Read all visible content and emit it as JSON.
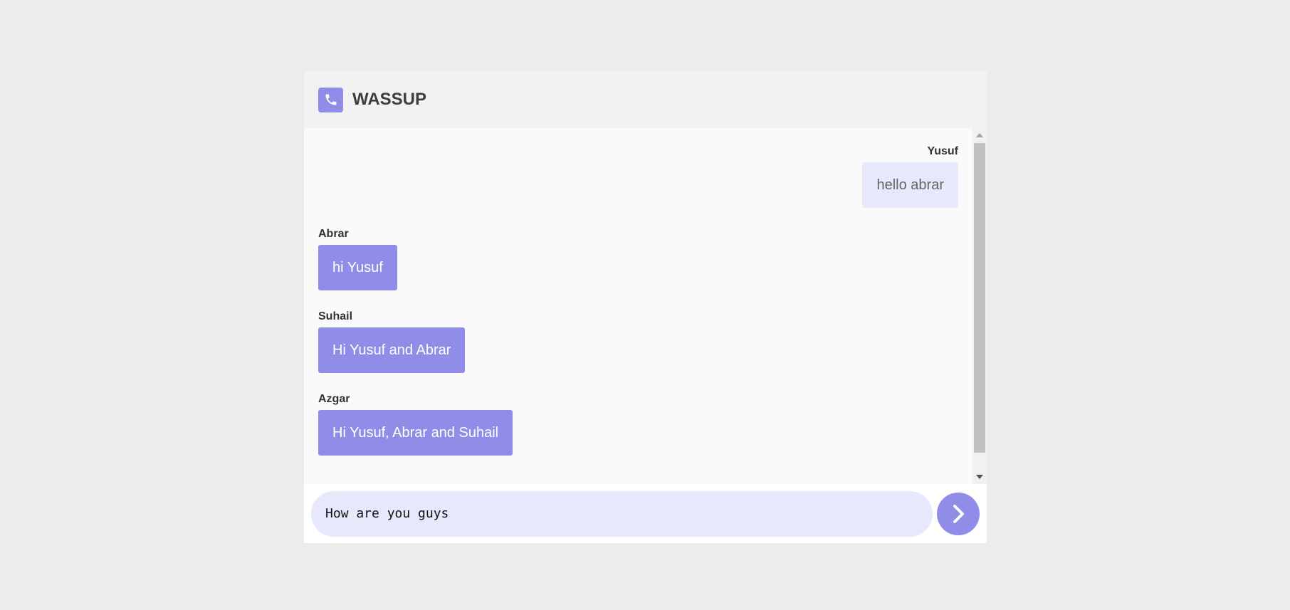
{
  "app": {
    "title": "WASSUP",
    "logo_icon": "phone-icon",
    "accent_color": "#8f8de8"
  },
  "messages": [
    {
      "sender": "Yusuf",
      "text": "hello abrar",
      "side": "right"
    },
    {
      "sender": "Abrar",
      "text": "hi Yusuf",
      "side": "left"
    },
    {
      "sender": "Suhail",
      "text": "Hi Yusuf and Abrar",
      "side": "left"
    },
    {
      "sender": "Azgar",
      "text": "Hi Yusuf, Abrar and Suhail",
      "side": "left"
    }
  ],
  "composer": {
    "value": "How are you guys",
    "send_icon": "chevron-right-icon"
  }
}
